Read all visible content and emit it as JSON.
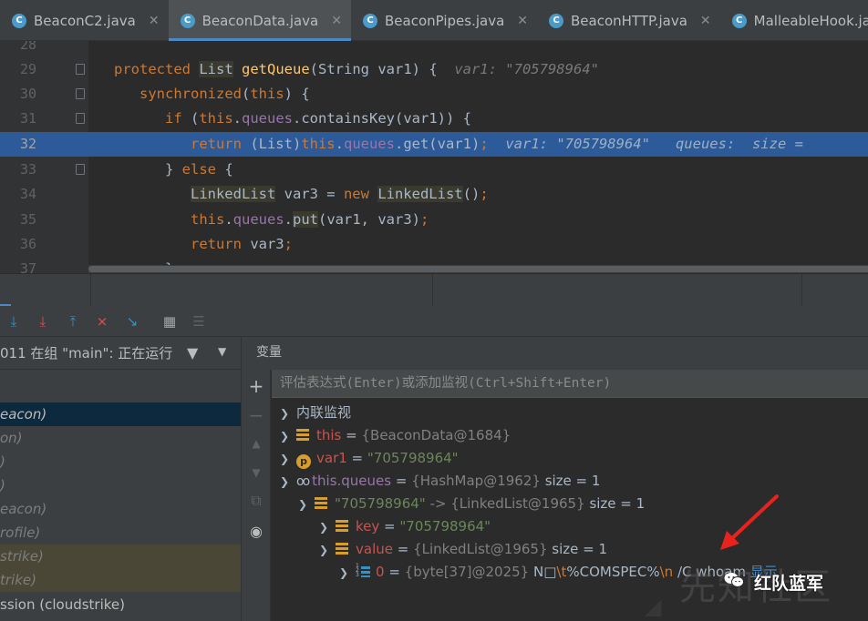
{
  "tabs": [
    {
      "name": "BeaconC2.java",
      "active": false
    },
    {
      "name": "BeaconData.java",
      "active": true
    },
    {
      "name": "BeaconPipes.java",
      "active": false
    },
    {
      "name": "BeaconHTTP.java",
      "active": false
    },
    {
      "name": "MalleableHook.java",
      "active": false
    }
  ],
  "editor": {
    "line_numbers": [
      "28",
      "29",
      "30",
      "31",
      "32",
      "33",
      "34",
      "35",
      "36",
      "37"
    ],
    "current_line": "32",
    "hints": {
      "line29": "var1: \"705798964\"",
      "line32_var1": "var1: \"705798964\"",
      "line32_queues": "queues:  size = "
    }
  },
  "debugger": {
    "thread_status": "011 在组 \"main\": 正在运行",
    "frames": [
      {
        "text": "eacon)",
        "state": "selected"
      },
      {
        "text": "on)",
        "state": "normal"
      },
      {
        "text": ")",
        "state": "normal"
      },
      {
        "text": ")",
        "state": "normal"
      },
      {
        "text": "eacon)",
        "state": "normal"
      },
      {
        "text": "rofile)",
        "state": "normal"
      },
      {
        "text": "strike)",
        "state": "library"
      },
      {
        "text": "trike)",
        "state": "library"
      },
      {
        "text": "ssion (cloudstrike)",
        "state": "normal"
      }
    ],
    "variables_title": "变量",
    "eval_placeholder": "评估表达式(Enter)或添加监视(Ctrl+Shift+Enter)",
    "variables": {
      "inline_watch": "内联监视",
      "this_name": "this",
      "this_value": "{BeaconData@1684}",
      "var1_name": "var1",
      "var1_value": "\"705798964\"",
      "queues_name": "this.queues",
      "queues_value": "{HashMap@1962}",
      "queues_size": "size = 1",
      "entry_key": "\"705798964\"",
      "entry_value": "{LinkedList@1965}",
      "entry_size": "size = 1",
      "key_name": "key",
      "key_value": "\"705798964\"",
      "value_name": "value",
      "value_value": "{LinkedList@1965}",
      "value_size": "size = 1",
      "item_index": "0",
      "item_obj": "{byte[37]@2025}",
      "item_text_a": "N",
      "item_text_b": "\\t",
      "item_text_c": "%COMSPEC%",
      "item_text_d": "\\n",
      "item_text_e": " /C whoam",
      "item_link": "显示"
    }
  },
  "watermark": {
    "cn_text": "先知社区",
    "brand": "红队蓝军"
  },
  "colors": {
    "accent": "#4a88c7",
    "highlight": "#2d5b9a",
    "annotation_arrow": "#e8221c"
  }
}
